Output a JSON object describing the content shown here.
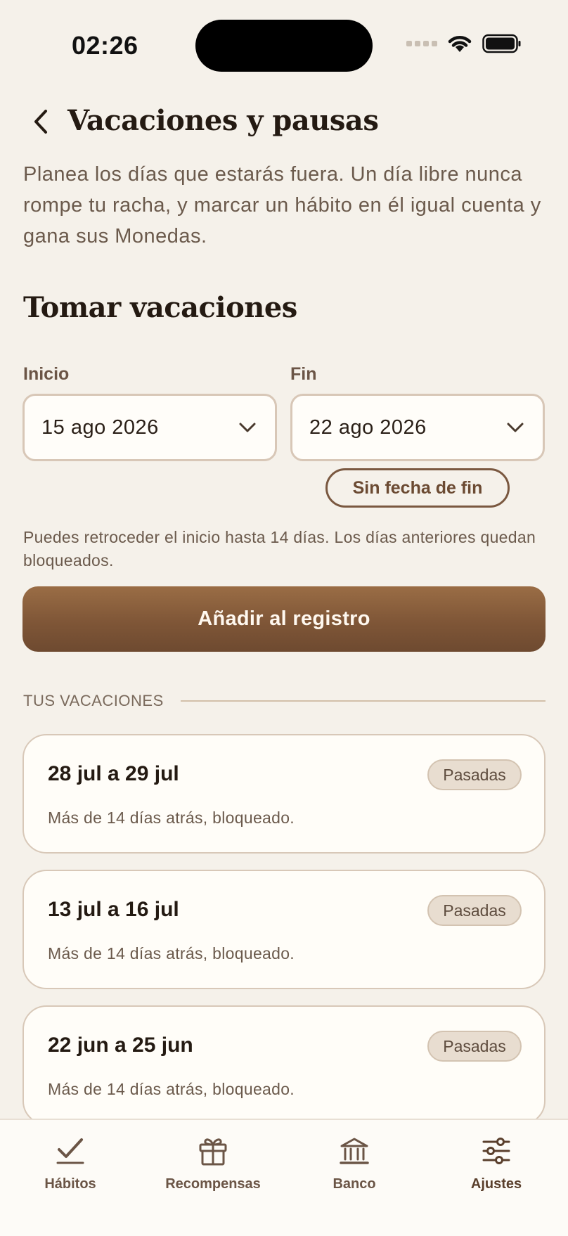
{
  "status_bar": {
    "time": "02:26"
  },
  "header": {
    "title": "Vacaciones y pausas"
  },
  "intro": "Planea los días que estarás fuera. Un día libre nunca rompe tu racha, y marcar un hábito en él igual cuenta y gana sus Monedas.",
  "form": {
    "section_title": "Tomar vacaciones",
    "start_label": "Inicio",
    "start_value": "15 ago 2026",
    "end_label": "Fin",
    "end_value": "22 ago 2026",
    "no_end_label": "Sin fecha de fin",
    "hint": "Puedes retroceder el inicio hasta 14 días. Los días anteriores quedan bloqueados.",
    "submit_label": "Añadir al registro"
  },
  "vacations": {
    "header": "TUS VACACIONES",
    "items": [
      {
        "range": "28 jul a 29 jul",
        "badge": "Pasadas",
        "note": "Más de 14 días atrás, bloqueado."
      },
      {
        "range": "13 jul a 16 jul",
        "badge": "Pasadas",
        "note": "Más de 14 días atrás, bloqueado."
      },
      {
        "range": "22 jun a 25 jun",
        "badge": "Pasadas",
        "note": "Más de 14 días atrás, bloqueado."
      }
    ]
  },
  "tabbar": {
    "active": "Ajustes",
    "items": [
      {
        "label": "Hábitos",
        "icon": "check-icon"
      },
      {
        "label": "Recompensas",
        "icon": "gift-icon"
      },
      {
        "label": "Banco",
        "icon": "bank-icon"
      },
      {
        "label": "Ajustes",
        "icon": "sliders-icon"
      }
    ]
  },
  "colors": {
    "background": "#f5f1ea",
    "accent": "#7f5637",
    "text": "#241a12",
    "muted": "#6b5a4c"
  }
}
